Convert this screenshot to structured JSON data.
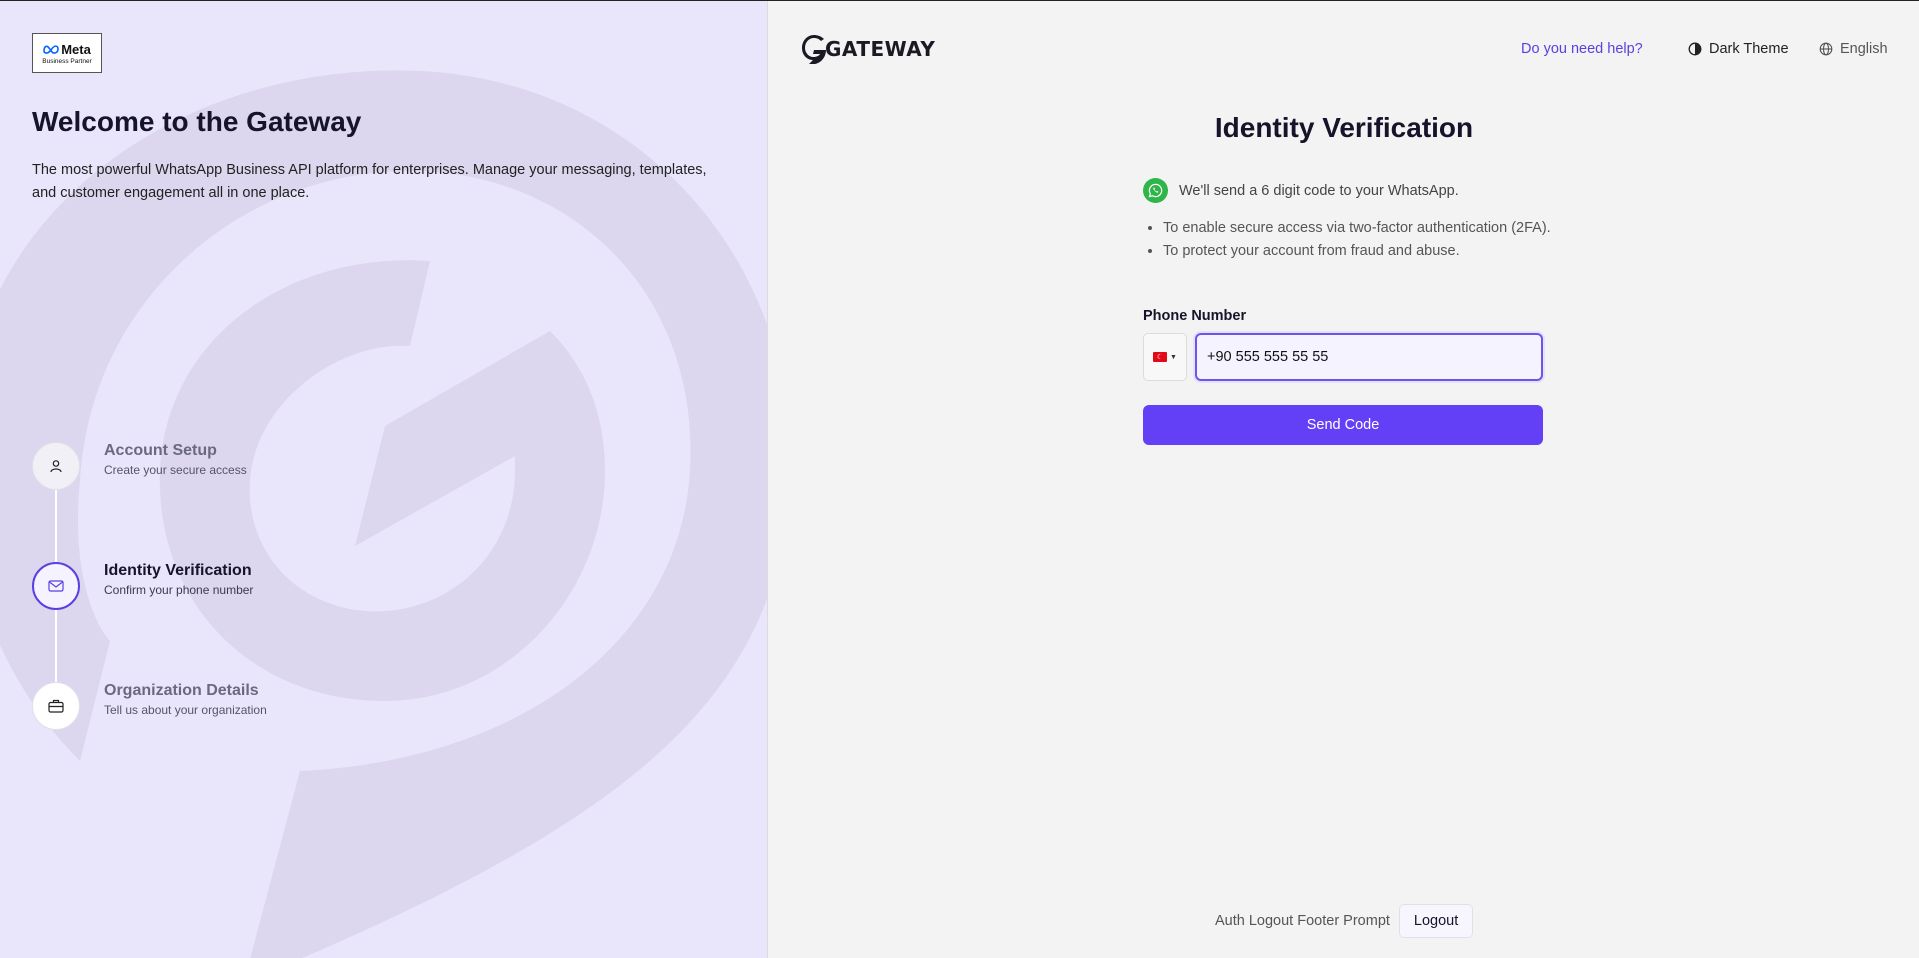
{
  "brand": {
    "meta_name": "Meta",
    "meta_sub": "Business Partner",
    "gateway_logo": "GATEWAY"
  },
  "left": {
    "welcome": "Welcome to the Gateway",
    "description": "The most powerful WhatsApp Business API platform for enterprises. Manage your messaging, templates, and customer engagement all in one place.",
    "steps": [
      {
        "title": "Account Setup",
        "subtitle": "Create your secure access",
        "icon": "user-icon",
        "state": "completed"
      },
      {
        "title": "Identity Verification",
        "subtitle": "Confirm your phone number",
        "icon": "mail-icon",
        "state": "active"
      },
      {
        "title": "Organization Details",
        "subtitle": "Tell us about your organization",
        "icon": "briefcase-icon",
        "state": "pending"
      }
    ]
  },
  "header": {
    "help": "Do you need help?",
    "theme": "Dark Theme",
    "language": "English"
  },
  "form": {
    "title": "Identity Verification",
    "whatsapp_note": "We'll send a 6 digit code to your WhatsApp.",
    "bullets": [
      "To enable secure access via two-factor authentication (2FA).",
      "To protect your account from fraud and abuse."
    ],
    "phone_label": "Phone Number",
    "country": "TR",
    "phone_value": "+90 555 555 55 55",
    "send_button": "Send Code"
  },
  "footer": {
    "prompt": "Auth Logout Footer Prompt",
    "logout": "Logout"
  },
  "colors": {
    "accent": "#6340f5",
    "left_bg": "#e9e5fb",
    "right_bg": "#f3f3f3",
    "whatsapp": "#2fb548"
  }
}
